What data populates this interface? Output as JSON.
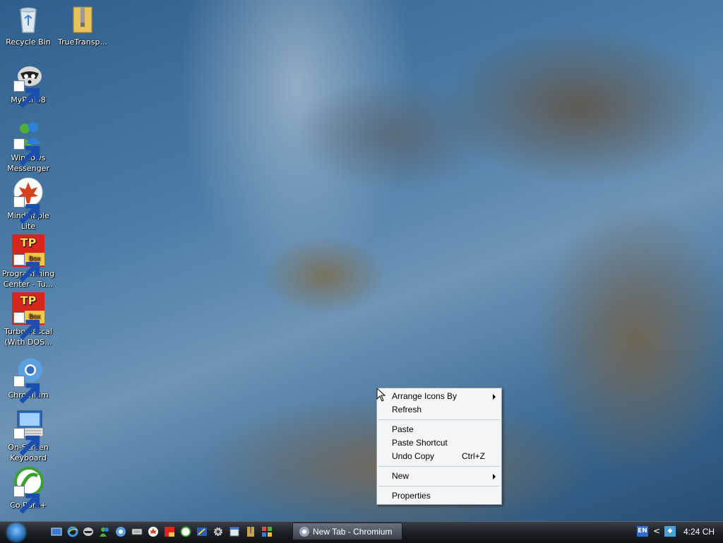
{
  "desktop": {
    "icons": [
      {
        "label": "Recycle Bin",
        "icon": "recycle-bin-icon"
      },
      {
        "label": "TrueTransp...",
        "icon": "zip-folder-icon"
      },
      {
        "label": "MyPal 68",
        "icon": "raccoon-browser-icon"
      },
      {
        "label": "Windows Messenger",
        "icon": "messenger-icon"
      },
      {
        "label": "MindMaple Lite",
        "icon": "maple-leaf-icon"
      },
      {
        "label": "Programming Center - Tu...",
        "icon": "tp-box-icon"
      },
      {
        "label": "Turbo Pascal (With DOS...",
        "icon": "tp-box-icon"
      },
      {
        "label": "Chromium",
        "icon": "chromium-icon"
      },
      {
        "label": "On-Screen Keyboard",
        "icon": "keyboard-icon"
      },
      {
        "label": "Co Rom+",
        "icon": "co-rom-icon"
      }
    ],
    "tp_icon_text": {
      "top": "TP",
      "bottom": "Box"
    }
  },
  "context_menu": {
    "arrange_icons_by": "Arrange Icons By",
    "refresh": "Refresh",
    "paste": "Paste",
    "paste_shortcut": "Paste Shortcut",
    "undo_copy": "Undo Copy",
    "undo_copy_shortcut": "Ctrl+Z",
    "new": "New",
    "properties": "Properties"
  },
  "taskbar": {
    "task_button_label": "New Tab - Chromium",
    "tray_language": "EN",
    "clock": "4:24 CH"
  },
  "colors": {
    "menu_bg": "#f4f5f6",
    "taskbar_bg": "#1c2026",
    "tp_red": "#d9261c"
  }
}
